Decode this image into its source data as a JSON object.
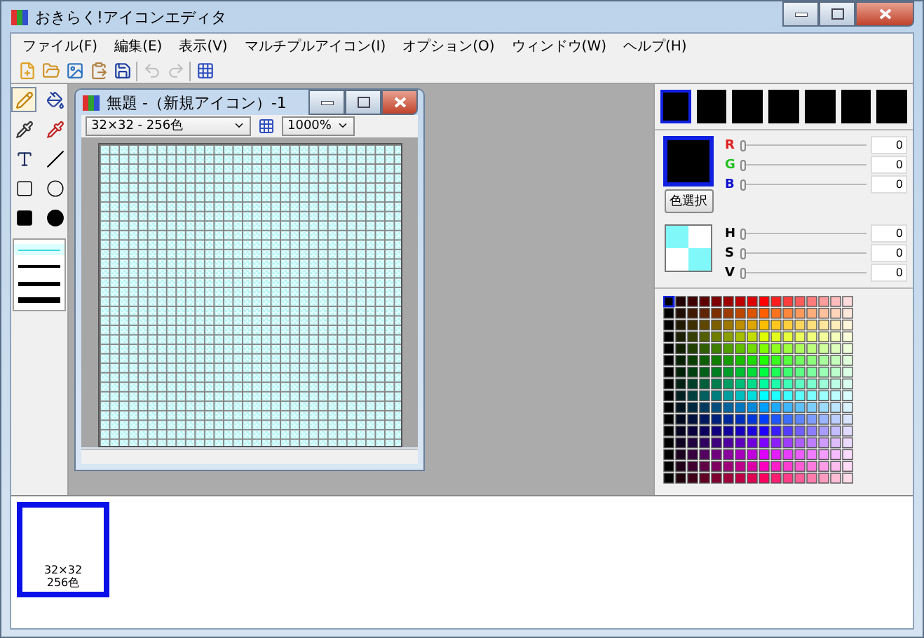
{
  "window": {
    "title": "おきらく!アイコンエディタ"
  },
  "menu": [
    "ファイル(F)",
    "編集(E)",
    "表示(V)",
    "マルチプルアイコン(I)",
    "オプション(O)",
    "ウィンドウ(W)",
    "ヘルプ(H)"
  ],
  "toolbar": [
    {
      "kind": "new",
      "disabled": false
    },
    {
      "kind": "open",
      "disabled": false
    },
    {
      "kind": "image",
      "disabled": false
    },
    {
      "kind": "paste",
      "disabled": false
    },
    {
      "kind": "save",
      "disabled": false
    },
    {
      "kind": "separator"
    },
    {
      "kind": "undo",
      "disabled": true
    },
    {
      "kind": "redo",
      "disabled": true
    },
    {
      "kind": "separator"
    },
    {
      "kind": "grid",
      "disabled": false
    }
  ],
  "tools": [
    {
      "kind": "pencil",
      "selected": true
    },
    {
      "kind": "fill",
      "selected": false
    },
    {
      "kind": "dropper",
      "selected": false
    },
    {
      "kind": "dropper-red",
      "selected": false
    },
    {
      "kind": "text",
      "selected": false
    },
    {
      "kind": "line",
      "selected": false
    },
    {
      "kind": "rect",
      "selected": false
    },
    {
      "kind": "ellipse",
      "selected": false
    },
    {
      "kind": "rect-fill",
      "selected": false
    },
    {
      "kind": "ellipse-fill",
      "selected": false
    }
  ],
  "line_widths": [
    {
      "selected": true
    },
    {
      "selected": false
    },
    {
      "selected": false
    },
    {
      "selected": false
    }
  ],
  "child_window": {
    "title": "無題 -（新規アイコン）-1",
    "format": "32×32 - 256色",
    "zoom": "1000%"
  },
  "recent_colors": [
    {
      "selected": true
    },
    {
      "selected": false
    },
    {
      "selected": false
    },
    {
      "selected": false
    },
    {
      "selected": false
    },
    {
      "selected": false
    },
    {
      "selected": false
    }
  ],
  "rgb": [
    {
      "label": "R",
      "color": "#e02020",
      "level": 0,
      "reading": "0"
    },
    {
      "label": "G",
      "color": "#20c020",
      "level": 0,
      "reading": "0"
    },
    {
      "label": "B",
      "color": "#1010d0",
      "level": 0,
      "reading": "0"
    }
  ],
  "pick_button": "色選択",
  "hsv": [
    {
      "label": "H",
      "level": 0,
      "reading": "0"
    },
    {
      "label": "S",
      "level": 0,
      "reading": "0"
    },
    {
      "label": "V",
      "level": 0,
      "reading": "0"
    }
  ],
  "icons": [
    {
      "size": "32×32",
      "depth": "256色",
      "selected": true
    }
  ]
}
